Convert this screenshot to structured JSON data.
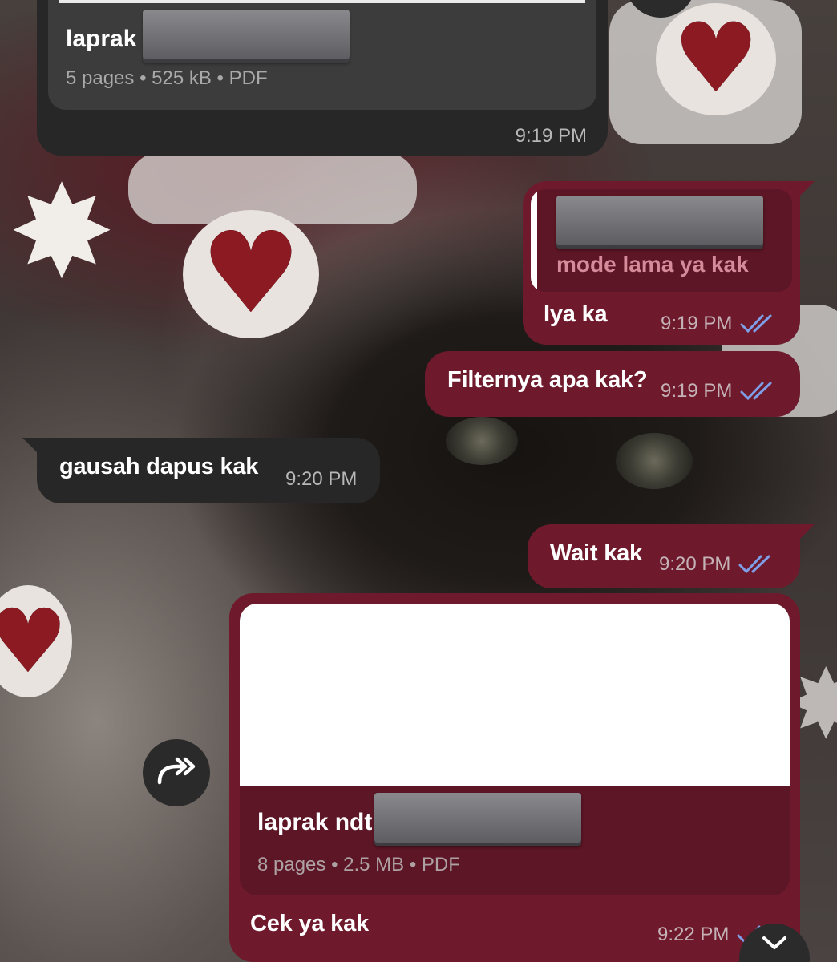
{
  "messages": [
    {
      "id": "doc-in",
      "direction": "incoming",
      "type": "document",
      "file_name": "laprak",
      "file_info": "5 pages • 525 kB • PDF",
      "time": "9:19 PM"
    },
    {
      "id": "reply-out",
      "direction": "outgoing",
      "type": "text-reply",
      "quoted_text": "mode lama ya kak",
      "text": "Iya ka",
      "time": "9:19 PM",
      "status": "read"
    },
    {
      "id": "filter-out",
      "direction": "outgoing",
      "type": "text",
      "text": "Filternya apa kak?",
      "time": "9:19 PM",
      "status": "read"
    },
    {
      "id": "gausah-in",
      "direction": "incoming",
      "type": "text",
      "text": "gausah dapus kak",
      "time": "9:20 PM"
    },
    {
      "id": "wait-out",
      "direction": "outgoing",
      "type": "text",
      "text": "Wait kak",
      "time": "9:20 PM",
      "status": "read"
    },
    {
      "id": "doc-out",
      "direction": "outgoing",
      "type": "document",
      "file_name": "laprak ndt",
      "file_info": "8 pages • 2.5 MB • PDF",
      "caption": "Cek ya kak",
      "time": "9:22 PM",
      "status": "read"
    }
  ],
  "icons": {
    "forward": "forward-icon",
    "scroll_down": "chevron-down-icon",
    "read_receipt": "double-check-icon"
  },
  "colors": {
    "incoming_bubble": "#272727",
    "outgoing_bubble": "#6e1a2c",
    "read_tick": "#7f9ee8",
    "quote_text": "#d58b99"
  }
}
